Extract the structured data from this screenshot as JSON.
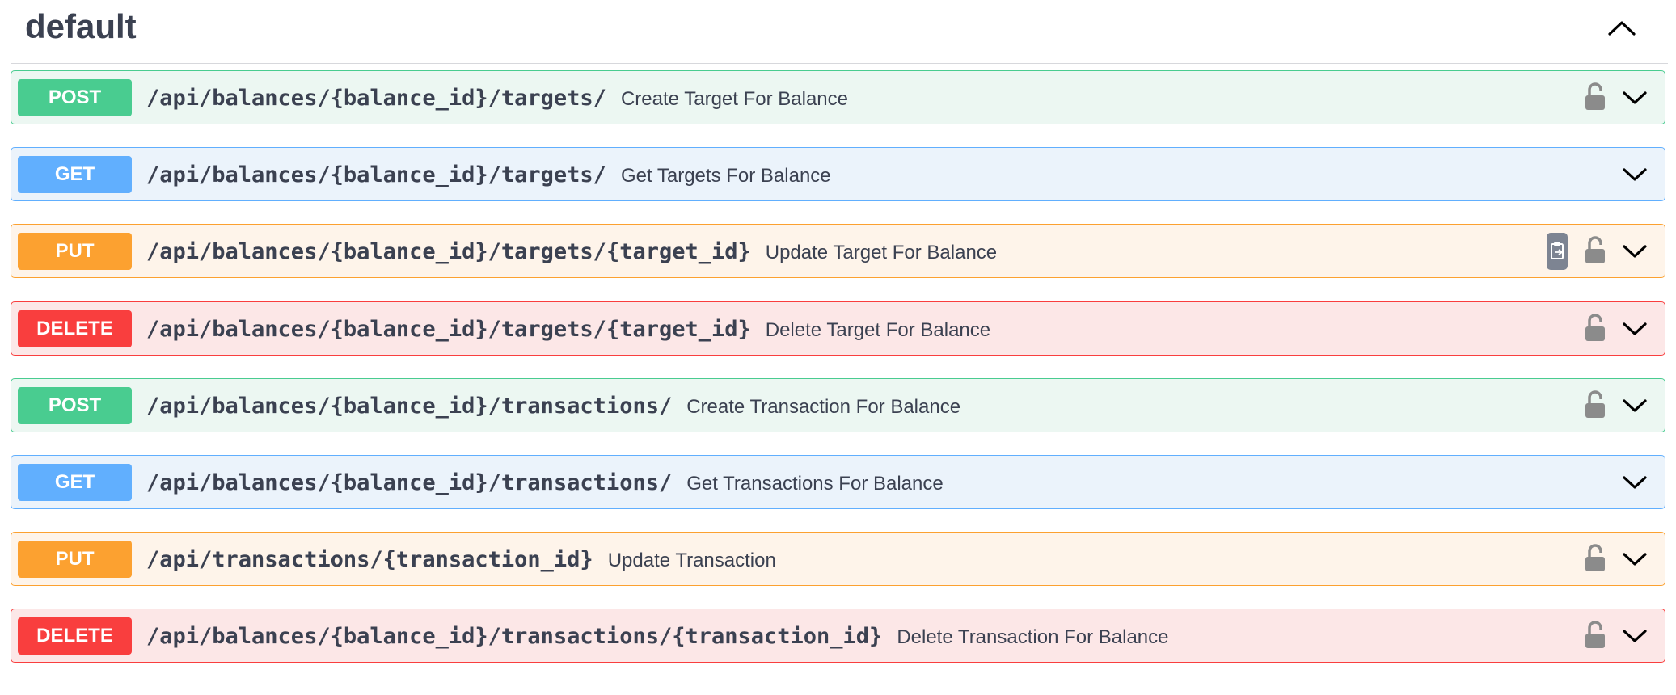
{
  "section": {
    "title": "default",
    "toggle_icon": "chevron-up-icon"
  },
  "operations": [
    {
      "method": "POST",
      "path": "/api/balances/{balance_id}/targets/",
      "summary": "Create Target For Balance",
      "locked": true
    },
    {
      "method": "GET",
      "path": "/api/balances/{balance_id}/targets/",
      "summary": "Get Targets For Balance",
      "locked": false
    },
    {
      "method": "PUT",
      "path": "/api/balances/{balance_id}/targets/{target_id}",
      "summary": "Update Target For Balance",
      "locked": true,
      "copy_button": true
    },
    {
      "method": "DELETE",
      "path": "/api/balances/{balance_id}/targets/{target_id}",
      "summary": "Delete Target For Balance",
      "locked": true
    },
    {
      "method": "POST",
      "path": "/api/balances/{balance_id}/transactions/",
      "summary": "Create Transaction For Balance",
      "locked": true
    },
    {
      "method": "GET",
      "path": "/api/balances/{balance_id}/transactions/",
      "summary": "Get Transactions For Balance",
      "locked": false
    },
    {
      "method": "PUT",
      "path": "/api/transactions/{transaction_id}",
      "summary": "Update Transaction",
      "locked": true
    },
    {
      "method": "DELETE",
      "path": "/api/balances/{balance_id}/transactions/{transaction_id}",
      "summary": "Delete Transaction For Balance",
      "locked": true
    }
  ],
  "colors": {
    "post": "#49cc90",
    "get": "#61affe",
    "put": "#fca130",
    "delete": "#f93e3e",
    "text": "#3b4151"
  }
}
